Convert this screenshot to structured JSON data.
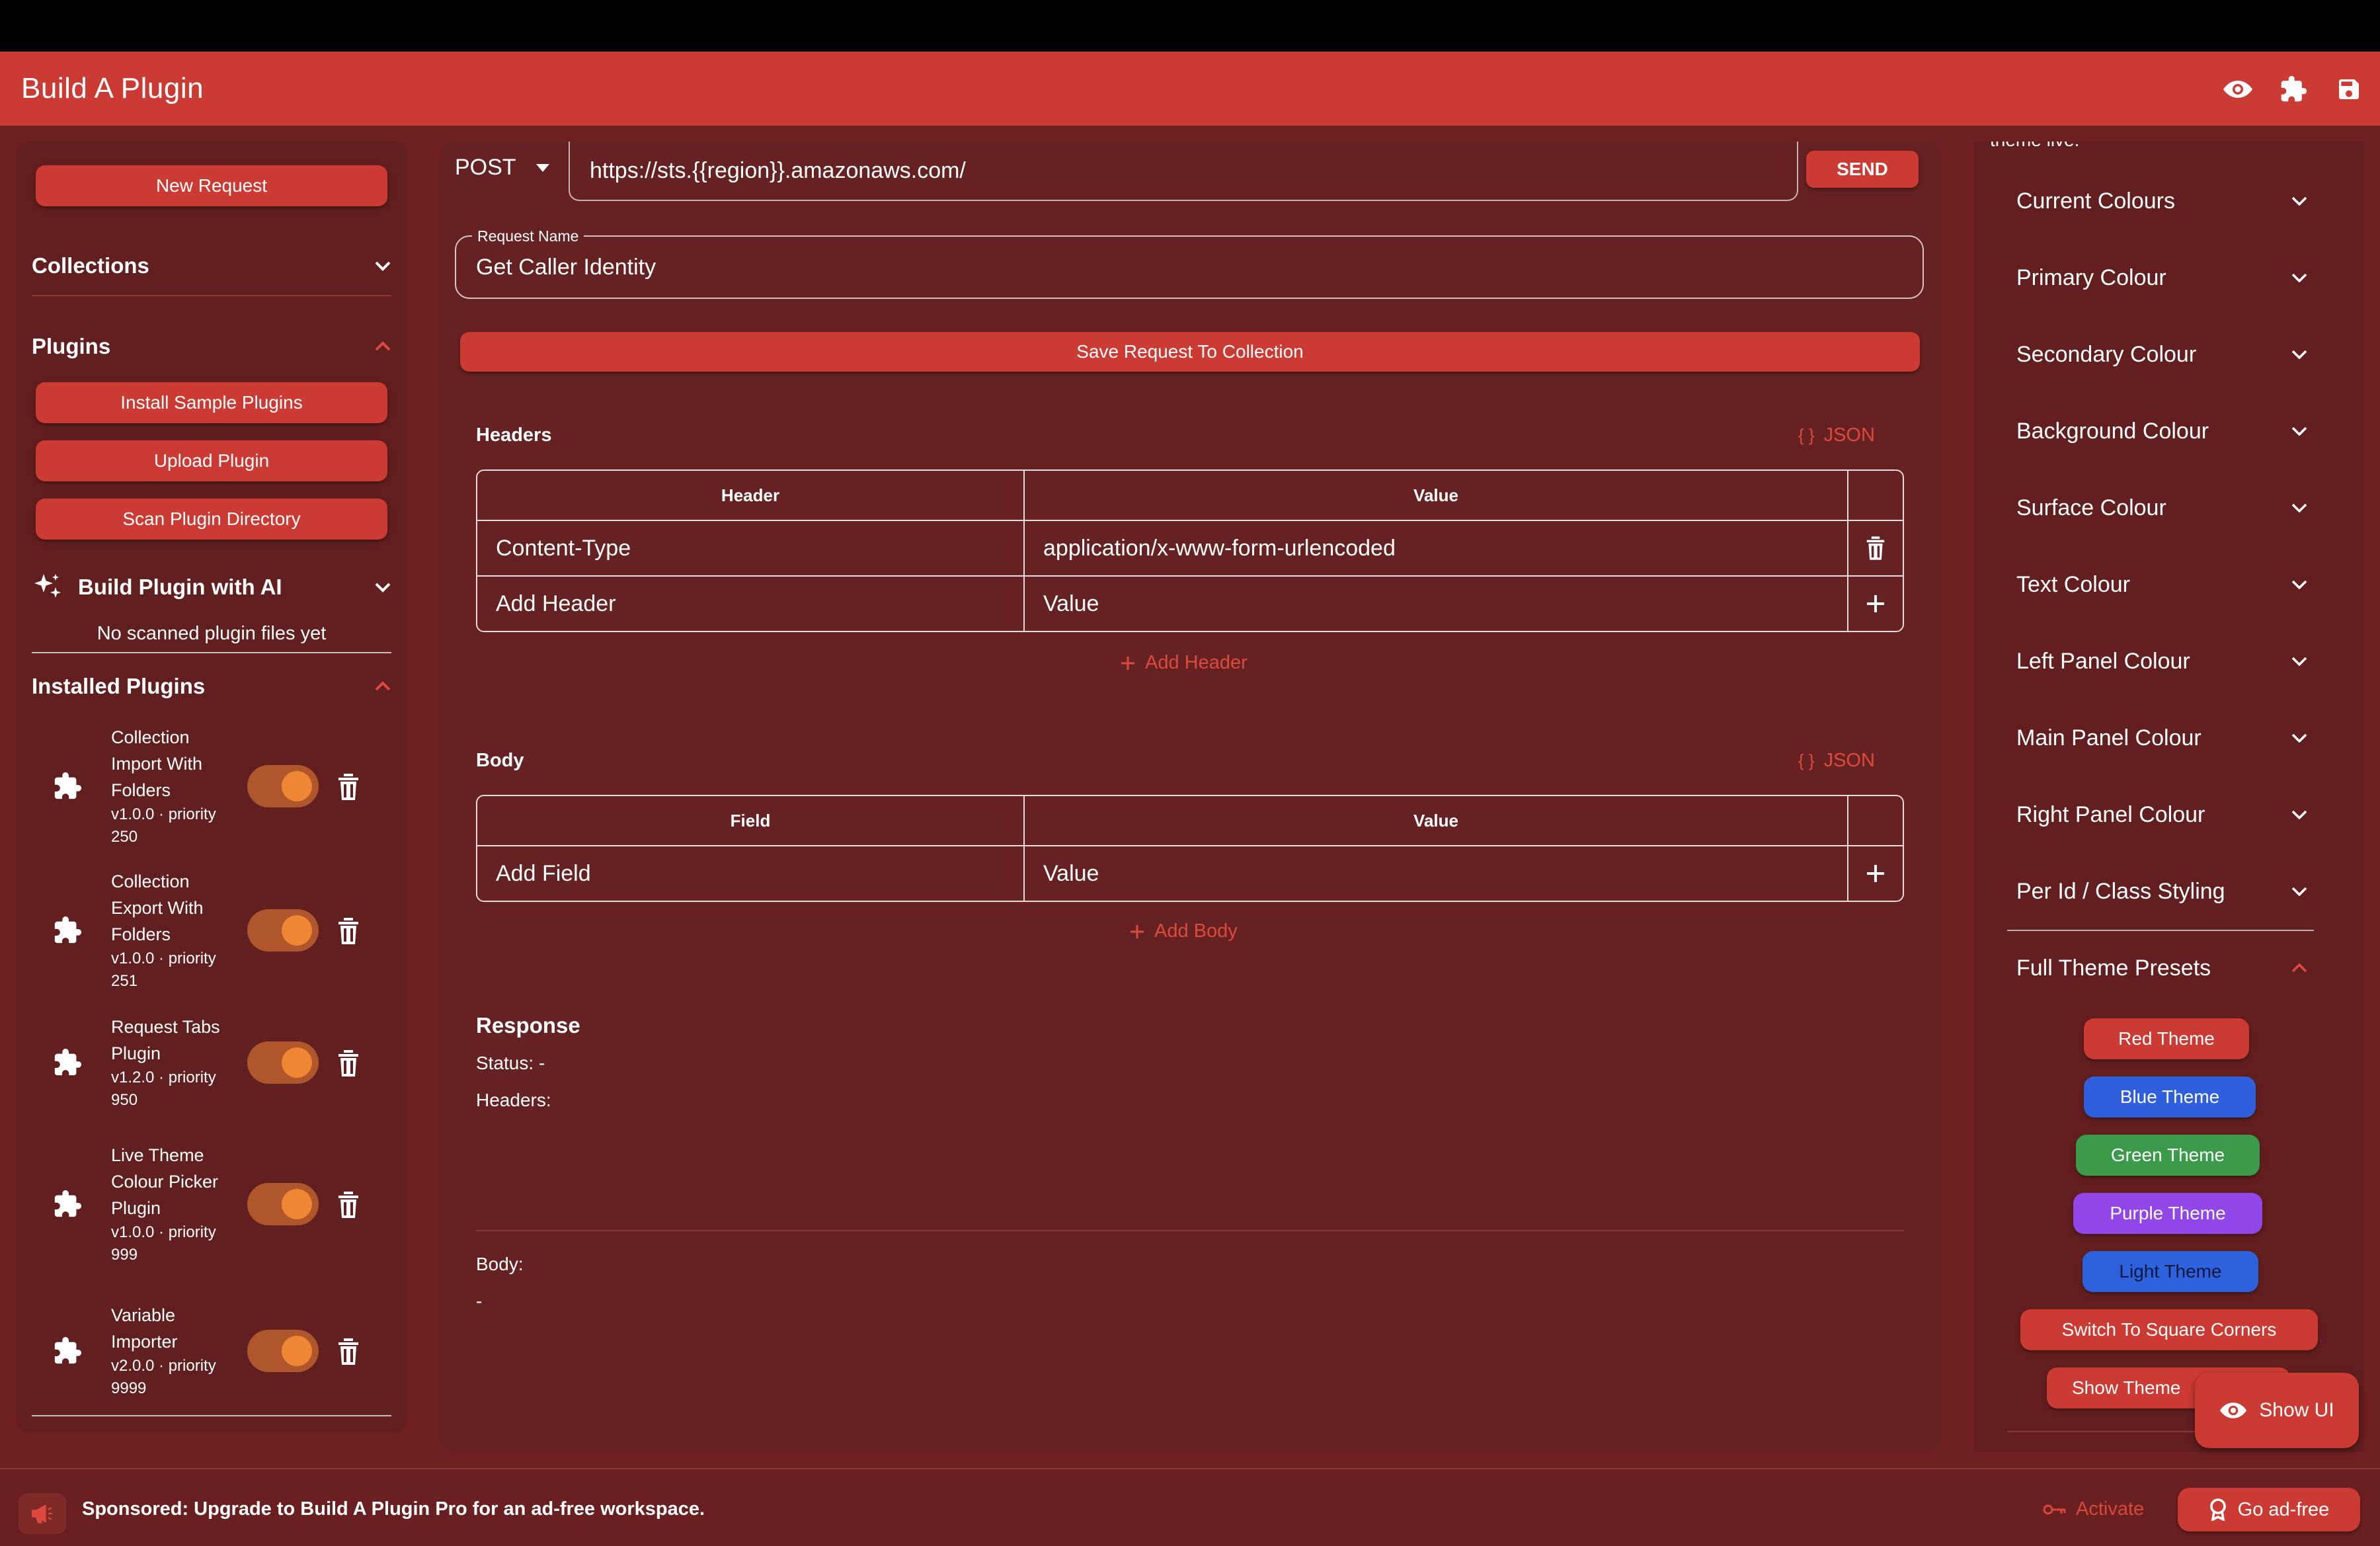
{
  "app": {
    "title": "Build A Plugin"
  },
  "header_icons": [
    "eye-icon",
    "puzzle-icon",
    "save-icon"
  ],
  "left": {
    "new_request": "New Request",
    "collections": "Collections",
    "plugins": "Plugins",
    "install_sample": "Install Sample Plugins",
    "upload_plugin": "Upload Plugin",
    "scan_dir": "Scan Plugin Directory",
    "build_ai": "Build Plugin with AI",
    "no_scanned": "No scanned plugin files yet",
    "installed": "Installed Plugins",
    "plugins_list": [
      {
        "name": "Collection Import With Folders",
        "meta": "v1.0.0 · priority 250",
        "enabled": true
      },
      {
        "name": "Collection Export With Folders",
        "meta": "v1.0.0 · priority 251",
        "enabled": true
      },
      {
        "name": "Request Tabs Plugin",
        "meta": "v1.2.0 · priority 950",
        "enabled": true
      },
      {
        "name": "Live Theme Colour Picker Plugin",
        "meta": "v1.0.0 · priority 999",
        "enabled": true
      },
      {
        "name": "Variable Importer",
        "meta": "v2.0.0 · priority 9999",
        "enabled": true
      }
    ]
  },
  "request": {
    "method": "POST",
    "url": "https://sts.{{region}}.amazonaws.com/",
    "send": "SEND",
    "name_label": "Request Name",
    "name_value": "Get Caller Identity",
    "save": "Save Request To Collection"
  },
  "headers": {
    "title": "Headers",
    "json": "JSON",
    "col_header": "Header",
    "col_value": "Value",
    "rows": [
      {
        "key": "Content-Type",
        "value": "application/x-www-form-urlencoded"
      }
    ],
    "new_key": "Add Header",
    "new_value": "Value",
    "add": "Add Header"
  },
  "body": {
    "title": "Body",
    "json": "JSON",
    "col_field": "Field",
    "col_value": "Value",
    "new_key": "Add Field",
    "new_value": "Value",
    "add": "Add Body"
  },
  "response": {
    "title": "Response",
    "status": "Status: -",
    "headers": "Headers:",
    "body_label": "Body:",
    "body_value": "-"
  },
  "right": {
    "cut_text": "theme live.",
    "items": [
      "Current Colours",
      "Primary Colour",
      "Secondary Colour",
      "Background Colour",
      "Surface Colour",
      "Text Colour",
      "Left Panel Colour",
      "Main Panel Colour",
      "Right Panel Colour",
      "Per Id / Class Styling"
    ],
    "presets": "Full Theme Presets",
    "themes": {
      "red": "Red Theme",
      "blue": "Blue Theme",
      "green": "Green Theme",
      "purple": "Purple Theme",
      "light": "Light Theme",
      "square": "Switch To Square Corners",
      "show_theme": "Show Theme"
    }
  },
  "show_ui": "Show UI",
  "footer": {
    "sponsor": "Sponsored: Upgrade to Build A Plugin Pro for an ad-free workspace.",
    "activate": "Activate",
    "go_adfree": "Go ad-free"
  },
  "colors": {
    "accent": "#cc3b33",
    "background": "#6e2020",
    "toggle_knob": "#ee8633",
    "blue_theme": "#2f5fdc",
    "green_theme": "#3c9b4b",
    "purple_theme": "#9146e8",
    "light_theme": "#2e62dc"
  }
}
